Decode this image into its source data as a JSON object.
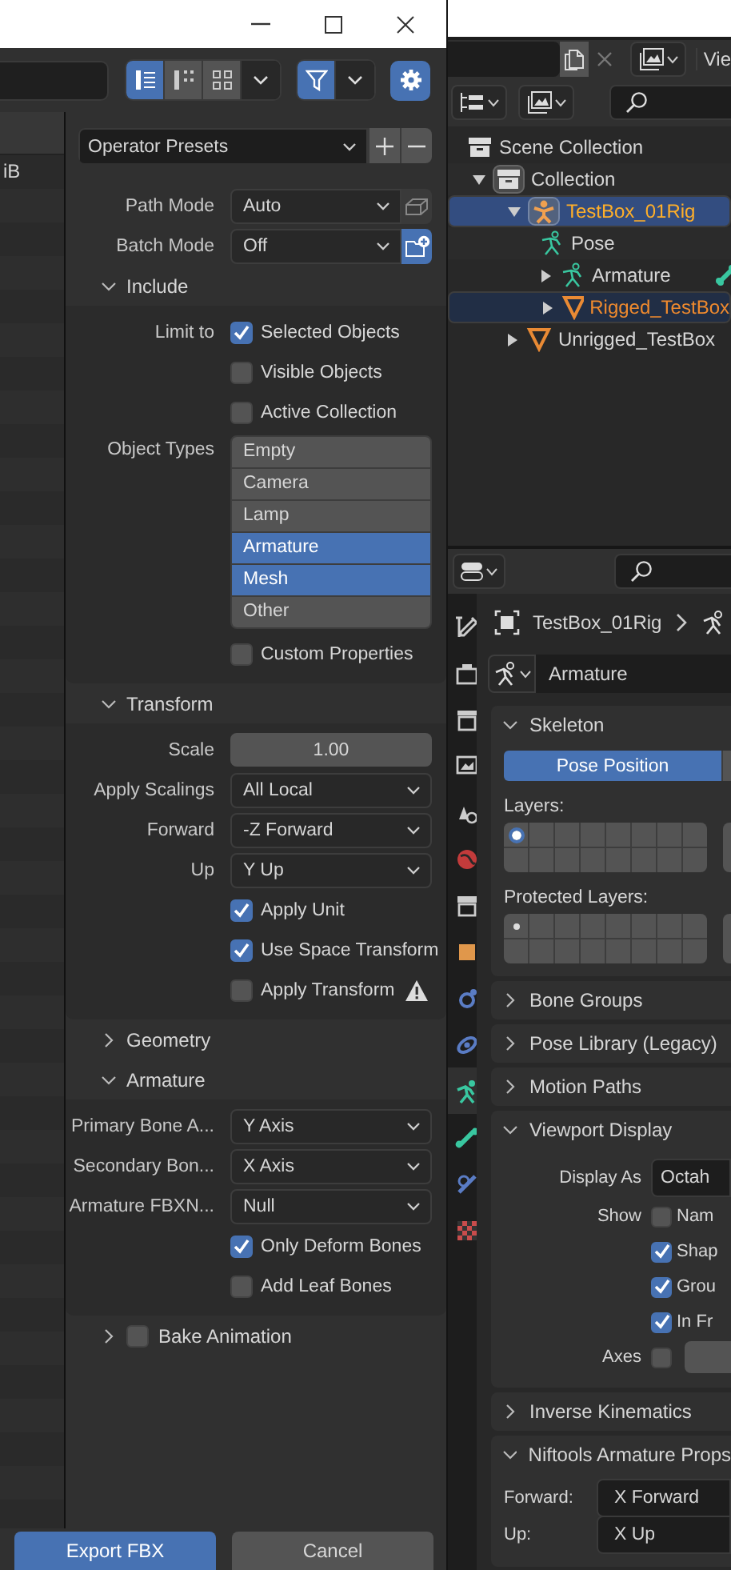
{
  "dialog": {
    "view_modes": [
      {
        "kind": "list",
        "selected": true
      },
      {
        "kind": "columns",
        "selected": false
      },
      {
        "kind": "thumbnails",
        "selected": false
      }
    ],
    "filter": {
      "on": true
    },
    "file_list": {
      "size": "iB"
    },
    "presets": "Operator Presets",
    "top_rows": [
      {
        "kind": "select",
        "label": "Path Mode",
        "value": "Auto",
        "toggle": {
          "on": false
        }
      },
      {
        "kind": "select",
        "label": "Batch Mode",
        "value": "Off",
        "toggle": {
          "on": true
        }
      }
    ],
    "sections": [
      {
        "title": "Include",
        "expanded": true,
        "rows": [
          {
            "kind": "checkbox",
            "label": "Limit to",
            "text": "Selected Objects",
            "checked": true
          },
          {
            "kind": "checkbox",
            "text": "Visible Objects",
            "checked": false
          },
          {
            "kind": "checkbox",
            "text": "Active Collection",
            "checked": false
          },
          {
            "kind": "listbox",
            "label": "Object Types",
            "options": [
              {
                "text": "Empty",
                "selected": false
              },
              {
                "text": "Camera",
                "selected": false
              },
              {
                "text": "Lamp",
                "selected": false
              },
              {
                "text": "Armature",
                "selected": true
              },
              {
                "text": "Mesh",
                "selected": true
              },
              {
                "text": "Other",
                "selected": false
              }
            ]
          },
          {
            "kind": "checkbox",
            "text": "Custom Properties",
            "checked": false
          }
        ]
      },
      {
        "title": "Transform",
        "expanded": true,
        "rows": [
          {
            "kind": "number",
            "label": "Scale",
            "value": "1.00"
          },
          {
            "kind": "select",
            "label": "Apply Scalings",
            "value": "All Local"
          },
          {
            "kind": "select",
            "label": "Forward",
            "value": "-Z Forward"
          },
          {
            "kind": "select",
            "label": "Up",
            "value": "Y Up"
          },
          {
            "kind": "checkbox",
            "text": "Apply Unit",
            "checked": true
          },
          {
            "kind": "checkbox",
            "text": "Use Space Transform",
            "checked": true
          },
          {
            "kind": "checkbox",
            "text": "Apply Transform",
            "checked": false,
            "warning": true
          }
        ]
      },
      {
        "title": "Geometry",
        "expanded": false
      },
      {
        "title": "Armature",
        "expanded": true,
        "rows": [
          {
            "kind": "select",
            "label": "Primary Bone A...",
            "value": "Y Axis"
          },
          {
            "kind": "select",
            "label": "Secondary Bon...",
            "value": "X Axis"
          },
          {
            "kind": "select",
            "label": "Armature FBXN...",
            "value": "Null"
          },
          {
            "kind": "checkbox",
            "text": "Only Deform Bones",
            "checked": true
          },
          {
            "kind": "checkbox",
            "text": "Add Leaf Bones",
            "checked": false
          }
        ]
      },
      {
        "title": "Bake Animation",
        "expanded": false,
        "checked": false
      }
    ],
    "buttons": [
      {
        "text": "Export FBX",
        "kind": "primary"
      },
      {
        "text": "Cancel",
        "kind": "secondary"
      }
    ]
  },
  "outliner": {
    "header_text": "Vie",
    "tree": [
      {
        "text": "Scene Collection",
        "kind": "scene",
        "children": [
          {
            "text": "Collection",
            "kind": "collection",
            "expanded": true,
            "children": [
              {
                "text": "TestBox_01Rig",
                "kind": "armature_object",
                "expanded": true,
                "selected": true,
                "active": true,
                "children": [
                  {
                    "text": "Pose",
                    "kind": "pose"
                  },
                  {
                    "text": "Armature",
                    "kind": "armature",
                    "expanded": false
                  },
                  {
                    "text": "Rigged_TestBox",
                    "kind": "mesh",
                    "expanded": false,
                    "selected": true,
                    "active": false
                  }
                ]
              },
              {
                "text": "Unrigged_TestBox",
                "kind": "mesh",
                "expanded": false,
                "selected": false,
                "active": false
              }
            ]
          }
        ]
      }
    ]
  },
  "properties": {
    "breadcrumb": "TestBox_01Rig",
    "data_name": "Armature",
    "tabs": [
      {
        "kind": "tool",
        "selected": false
      },
      {
        "kind": "render",
        "selected": false
      },
      {
        "kind": "output",
        "selected": false
      },
      {
        "kind": "view_layer",
        "selected": false
      },
      {
        "kind": "scene",
        "selected": false
      },
      {
        "kind": "world",
        "selected": false
      },
      {
        "kind": "collection",
        "selected": false
      },
      {
        "kind": "object",
        "selected": false
      },
      {
        "kind": "particles",
        "selected": false
      },
      {
        "kind": "physics",
        "selected": false
      },
      {
        "kind": "armature",
        "selected": true
      },
      {
        "kind": "bone",
        "selected": false
      },
      {
        "kind": "constraint",
        "selected": false
      },
      {
        "kind": "texture",
        "selected": false
      }
    ],
    "panels": [
      {
        "title": "Skeleton",
        "expanded": true,
        "kind": "skeleton",
        "pose_button": {
          "text": "Pose Position",
          "selected": true
        },
        "layers_label": "Layers:",
        "layers": [
          true,
          false,
          false,
          false,
          false,
          false,
          false,
          false,
          false,
          false,
          false,
          false,
          false,
          false,
          false,
          false
        ],
        "protected_label": "Protected Layers:",
        "protected_layers": [
          true,
          false,
          false,
          false,
          false,
          false,
          false,
          false,
          false,
          false,
          false,
          false,
          false,
          false,
          false,
          false
        ]
      },
      {
        "title": "Bone Groups",
        "expanded": false
      },
      {
        "title": "Pose Library (Legacy)",
        "expanded": false
      },
      {
        "title": "Motion Paths",
        "expanded": false
      },
      {
        "title": "Viewport Display",
        "expanded": true,
        "kind": "rows",
        "rows": [
          {
            "kind": "select",
            "label": "Display As",
            "value": "Octah"
          },
          {
            "kind": "checkbox",
            "label": "Show",
            "text": "Nam",
            "checked": false
          },
          {
            "kind": "checkbox",
            "text": "Shap",
            "checked": true
          },
          {
            "kind": "checkbox",
            "text": "Grou",
            "checked": true
          },
          {
            "kind": "checkbox",
            "text": "In Fr",
            "checked": true
          },
          {
            "kind": "axes",
            "label": "Axes",
            "checked": false
          }
        ]
      },
      {
        "title": "Inverse Kinematics",
        "expanded": false
      },
      {
        "title": "Niftools Armature Props",
        "expanded": true,
        "kind": "rows",
        "rows": [
          {
            "kind": "prop",
            "label": "Forward:",
            "value": "X Forward"
          },
          {
            "kind": "prop",
            "label": "Up:",
            "value": "X Up"
          }
        ]
      }
    ]
  }
}
